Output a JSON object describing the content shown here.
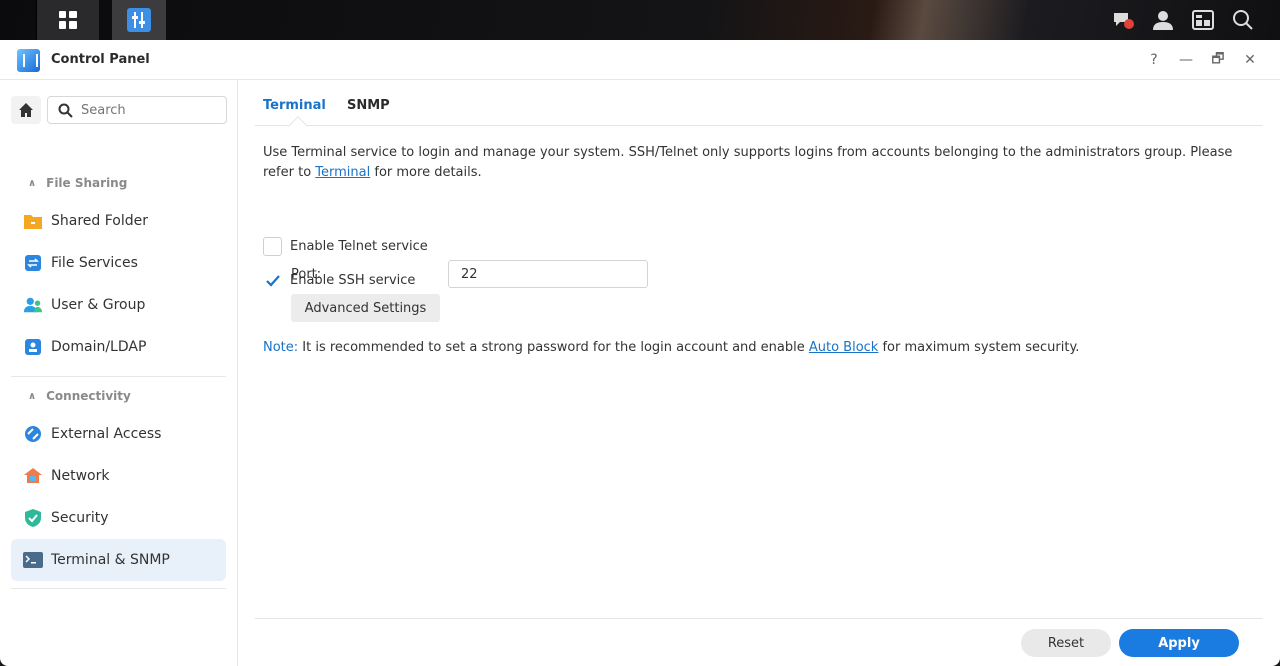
{
  "app": {
    "title": "Control Panel"
  },
  "window_controls": {
    "help": "?",
    "minimize": "—",
    "restore": "🗗",
    "close": "✕"
  },
  "sidebar": {
    "search_placeholder": "Search",
    "sections": [
      {
        "title": "File Sharing",
        "items": [
          {
            "label": "Shared Folder",
            "icon": "folder-icon"
          },
          {
            "label": "File Services",
            "icon": "file-services-icon"
          },
          {
            "label": "User & Group",
            "icon": "user-group-icon"
          },
          {
            "label": "Domain/LDAP",
            "icon": "domain-ldap-icon"
          }
        ]
      },
      {
        "title": "Connectivity",
        "items": [
          {
            "label": "External Access",
            "icon": "external-access-icon"
          },
          {
            "label": "Network",
            "icon": "network-icon"
          },
          {
            "label": "Security",
            "icon": "security-shield-icon"
          },
          {
            "label": "Terminal & SNMP",
            "icon": "terminal-icon",
            "active": true
          }
        ]
      }
    ]
  },
  "tabs": [
    {
      "label": "Terminal",
      "active": true
    },
    {
      "label": "SNMP",
      "active": false
    }
  ],
  "content": {
    "description_before": "Use Terminal service to login and manage your system. SSH/Telnet only supports logins from accounts belonging to the administrators group. Please refer to ",
    "description_link": "Terminal",
    "description_after": " for more details.",
    "telnet_label": "Enable Telnet service",
    "telnet_checked": false,
    "ssh_label": "Enable SSH service",
    "ssh_checked": true,
    "port_label": "Port:",
    "port_value": "22",
    "advanced_label": "Advanced Settings",
    "note_prefix": "Note:",
    "note_before": " It is recommended to set a strong password for the login account and enable ",
    "note_link": "Auto Block",
    "note_after": " for maximum system security."
  },
  "footer": {
    "reset_label": "Reset",
    "apply_label": "Apply"
  },
  "colors": {
    "accent": "#1a7be0",
    "link": "#1a73c8",
    "active_bg": "#e8f0fa"
  }
}
